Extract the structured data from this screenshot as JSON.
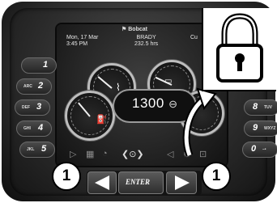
{
  "brand": "Bobcat",
  "status": {
    "date": "Mon, 17 Mar",
    "time": "3:45 PM",
    "operator": "BRADY",
    "hours": "232.5 hrs",
    "cut_text": "Cu"
  },
  "readout": {
    "rpm": "1300",
    "unit_icon": "engine-speed-icon"
  },
  "left_buttons": [
    {
      "small": "",
      "number": "1"
    },
    {
      "small": "ARC",
      "number": "2"
    },
    {
      "small": "DEF",
      "number": "3"
    },
    {
      "small": "GHI",
      "number": "4"
    },
    {
      "small": "JKL",
      "number": "5"
    }
  ],
  "right_buttons": [
    {
      "number": "8",
      "small": "TUV"
    },
    {
      "number": "9",
      "small": "WXYZ"
    },
    {
      "number": "0",
      "small": "–•"
    }
  ],
  "nav": {
    "enter_label": "ENTER"
  },
  "callouts": {
    "left": "1",
    "right": "1"
  },
  "icons": {
    "lock": "padlock-icon",
    "left_arrow": "left-arrow-icon",
    "right_arrow": "right-arrow-icon",
    "center_select": "select-knob-icon"
  }
}
